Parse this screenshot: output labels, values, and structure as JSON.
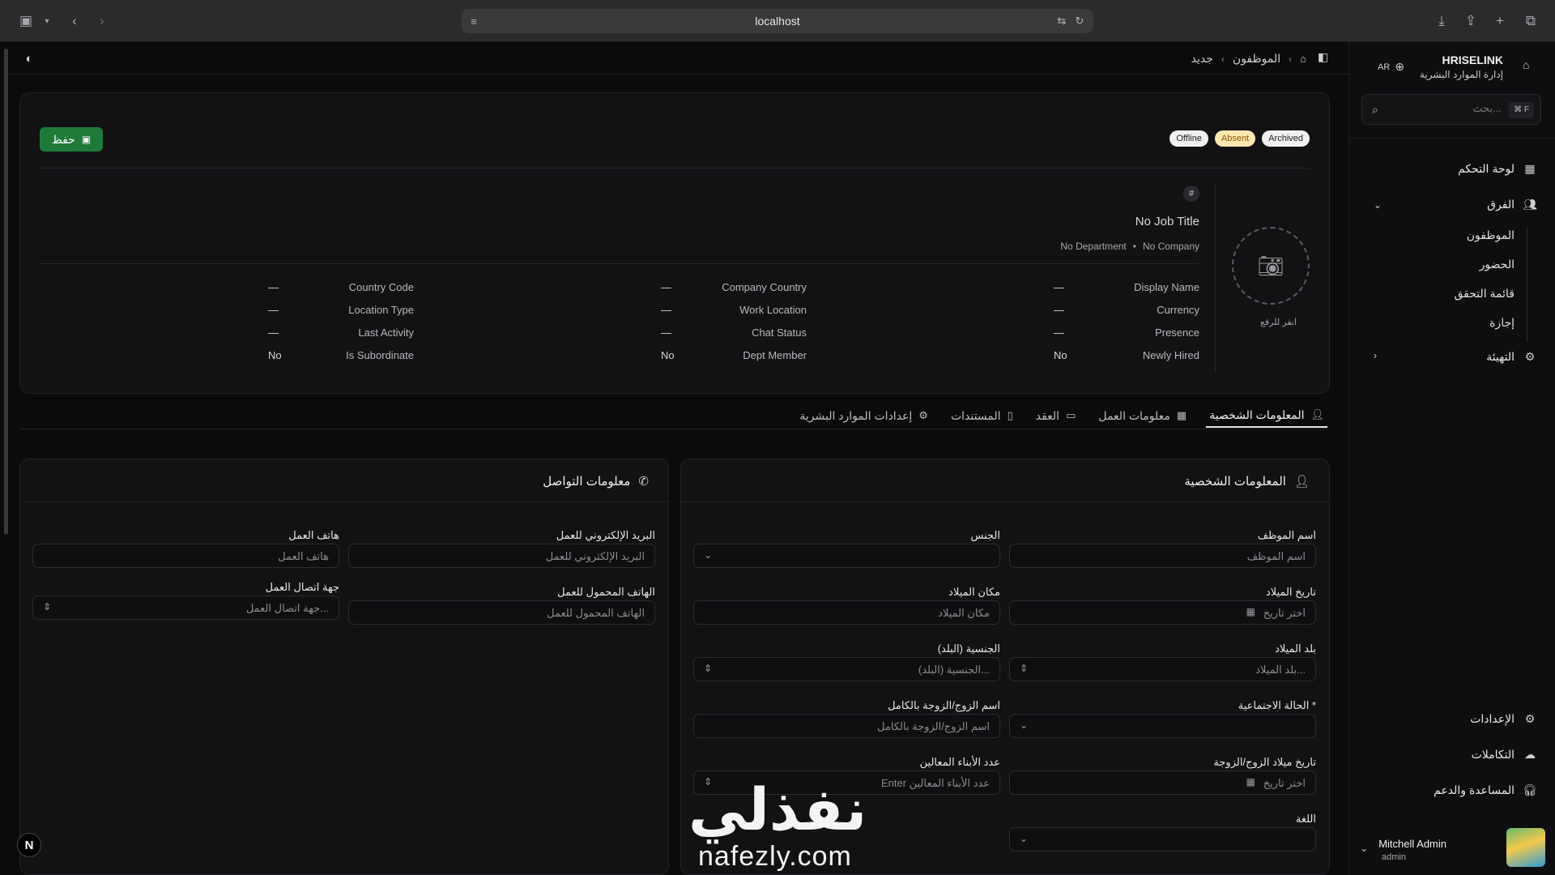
{
  "browser": {
    "url": "localhost",
    "icons": [
      "sidebar-icon",
      "chevron-down-icon",
      "back-icon",
      "forward-icon",
      "page-icon",
      "translate-icon",
      "reload-icon",
      "download-icon",
      "share-icon",
      "new-tab-icon",
      "tabs-overview-icon"
    ]
  },
  "sidebar": {
    "brand_name": "HRISELINK",
    "brand_sub": "إدارة الموارد البشرية",
    "lang": "AR",
    "search_placeholder": "بحث...",
    "search_kbd": "⌘ F",
    "items": [
      {
        "label": "لوحة التحكم",
        "icon": "dashboard-icon"
      },
      {
        "label": "الفرق",
        "icon": "users-icon"
      },
      {
        "label": "التهيئة",
        "icon": "gear-icon"
      }
    ],
    "sub_items": [
      "الموظفون",
      "الحضور",
      "قائمة التحقق",
      "إجازة"
    ],
    "bottom_items": [
      {
        "label": "الإعدادات",
        "icon": "gear-icon"
      },
      {
        "label": "التكاملات",
        "icon": "cloud-icon"
      },
      {
        "label": "المساعدة والدعم",
        "icon": "headset-icon"
      }
    ],
    "user": {
      "name": "Mitchell Admin",
      "role": "admin"
    }
  },
  "breadcrumb": {
    "items": [
      "الموظفون",
      "جديد"
    ]
  },
  "header_card": {
    "save_label": "حفظ",
    "badges": [
      "Archived",
      "Absent",
      "Offline"
    ],
    "hash": "#",
    "job_title": "No Job Title",
    "department": "No Department",
    "company": "No Company",
    "upload_label": "انقر للرفع",
    "fields": [
      {
        "key": "Display Name",
        "value": "—"
      },
      {
        "key": "Currency",
        "value": "—"
      },
      {
        "key": "Presence",
        "value": "—"
      },
      {
        "key": "Newly Hired",
        "value": "No"
      },
      {
        "key": "Company Country",
        "value": "—"
      },
      {
        "key": "Work Location",
        "value": "—"
      },
      {
        "key": "Chat Status",
        "value": "—"
      },
      {
        "key": "Dept Member",
        "value": "No"
      },
      {
        "key": "Country Code",
        "value": "—"
      },
      {
        "key": "Location Type",
        "value": "—"
      },
      {
        "key": "Last Activity",
        "value": "—"
      },
      {
        "key": "Is Subordinate",
        "value": "No"
      }
    ]
  },
  "tabs": [
    {
      "label": "المعلومات الشخصية",
      "active": true
    },
    {
      "label": "معلومات العمل",
      "active": false
    },
    {
      "label": "العقد",
      "active": false
    },
    {
      "label": "المستندات",
      "active": false
    },
    {
      "label": "إعدادات الموارد البشرية",
      "active": false
    }
  ],
  "personal_card": {
    "title": "المعلومات الشخصية",
    "fields": {
      "employee_name": {
        "label": "اسم الموظف",
        "placeholder": "اسم الموظف"
      },
      "gender": {
        "label": "الجنس",
        "placeholder": ""
      },
      "birth_date": {
        "label": "تاريخ الميلاد",
        "placeholder": "اختر تاريخ"
      },
      "birth_place": {
        "label": "مكان الميلاد",
        "placeholder": "مكان الميلاد"
      },
      "birth_country": {
        "label": "بلد الميلاد",
        "placeholder": "بلد الميلاد..."
      },
      "nationality": {
        "label": "الجنسية (البلد)",
        "placeholder": "الجنسية (البلد)..."
      },
      "marital_status": {
        "label": "الحالة الاجتماعية *",
        "placeholder": ""
      },
      "spouse_name": {
        "label": "اسم الزوج/الزوجة بالكامل",
        "placeholder": "اسم الزوج/الزوجة بالكامل"
      },
      "spouse_birth": {
        "label": "تاريخ ميلاد الزوج/الزوجة",
        "placeholder": "اختر تاريخ"
      },
      "children": {
        "label": "عدد الأبناء المعالين",
        "placeholder": "Enter عدد الأبناء المعالين"
      },
      "language": {
        "label": "اللغة",
        "placeholder": ""
      }
    }
  },
  "contact_card": {
    "title": "معلومات التواصل",
    "fields": {
      "work_email": {
        "label": "البريد الإلكتروني للعمل",
        "placeholder": "البريد الإلكتروني للعمل"
      },
      "work_phone": {
        "label": "هاتف العمل",
        "placeholder": "هاتف العمل"
      },
      "work_mobile": {
        "label": "الهاتف المحمول للعمل",
        "placeholder": "الهاتف المحمول للعمل"
      },
      "work_contact": {
        "label": "جهة اتصال العمل",
        "placeholder": "جهة اتصال العمل..."
      }
    }
  },
  "watermark": {
    "arabic": "نفذلي",
    "latin": "nafezly.com"
  },
  "dev_badge": "N"
}
